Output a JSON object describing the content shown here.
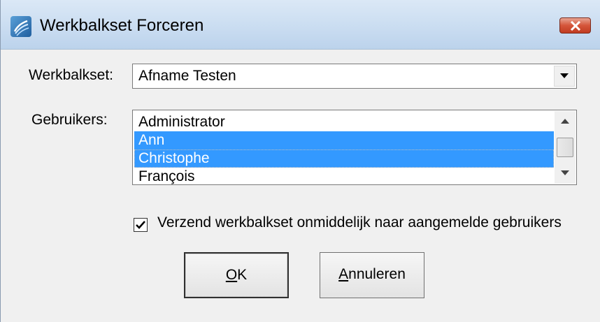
{
  "window": {
    "title": "Werkbalkset Forceren"
  },
  "form": {
    "toolbar_set_label": "Werkbalkset:",
    "toolbar_set_value": "Afname Testen",
    "users_label": "Gebruikers:",
    "users": [
      {
        "name": "Administrator",
        "selected": false
      },
      {
        "name": "Ann",
        "selected": true
      },
      {
        "name": "Christophe",
        "selected": true
      },
      {
        "name": "François",
        "selected": false
      }
    ],
    "send_immediately_label": "Verzend werkbalkset onmiddelijk naar aangemelde gebruikers",
    "send_immediately_checked": true
  },
  "buttons": {
    "ok_accel": "O",
    "ok_rest": "K",
    "cancel_accel": "A",
    "cancel_rest": "nnuleren"
  },
  "colors": {
    "selection": "#3399ff",
    "close_button": "#c0442a"
  }
}
